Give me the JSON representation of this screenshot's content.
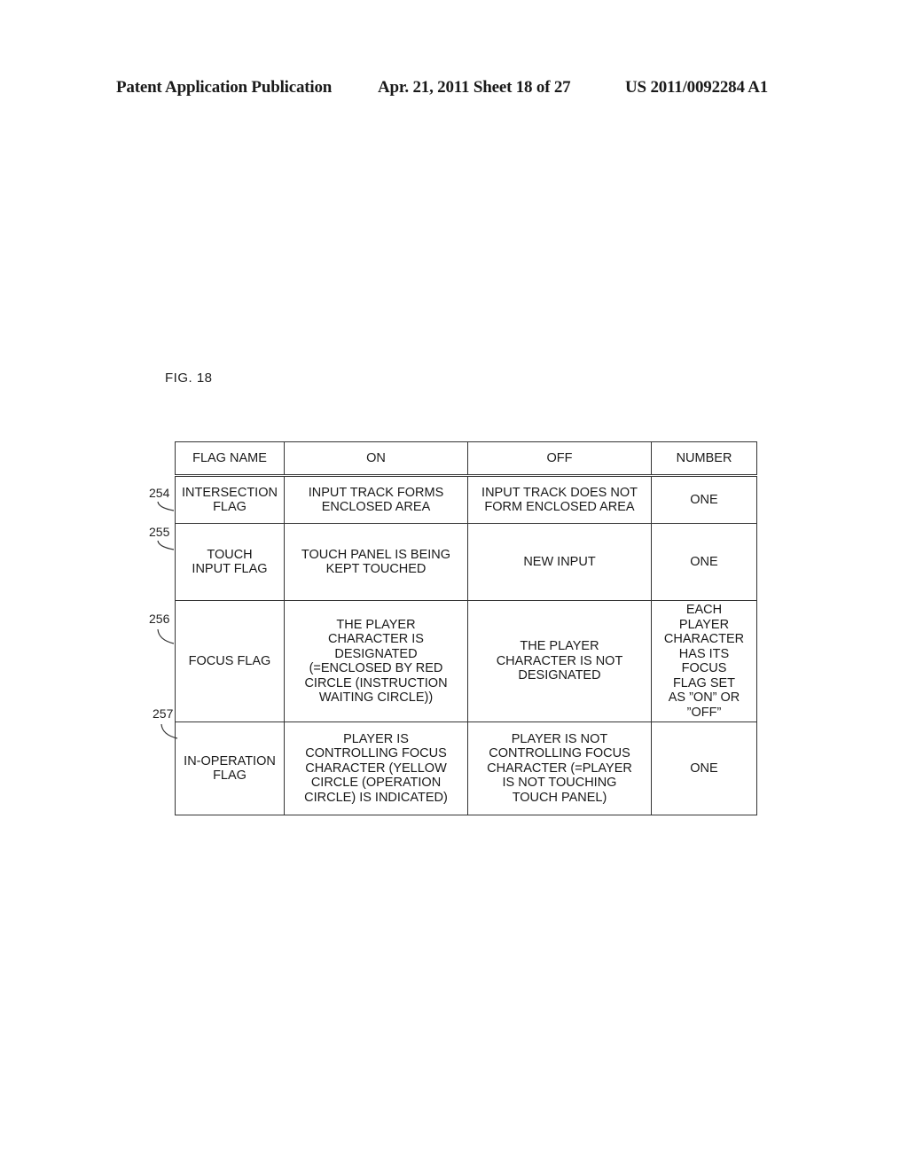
{
  "header": {
    "publication": "Patent Application Publication",
    "date_sheet": "Apr. 21, 2011  Sheet 18 of 27",
    "patent_number": "US 2011/0092284 A1"
  },
  "figure": {
    "label": "FIG. 18"
  },
  "table": {
    "columns": [
      "FLAG NAME",
      "ON",
      "OFF",
      "NUMBER"
    ],
    "rows": [
      {
        "ref": "254",
        "flag_name": "INTERSECTION\nFLAG",
        "on": "INPUT TRACK FORMS\nENCLOSED AREA",
        "off": "INPUT TRACK DOES NOT\nFORM ENCLOSED AREA",
        "number": "ONE"
      },
      {
        "ref": "255",
        "flag_name": "TOUCH\nINPUT FLAG",
        "on": "TOUCH PANEL IS BEING\nKEPT TOUCHED",
        "off": "NEW INPUT",
        "number": "ONE"
      },
      {
        "ref": "256",
        "flag_name": "FOCUS FLAG",
        "on": "THE PLAYER\nCHARACTER IS\nDESIGNATED\n(=ENCLOSED BY RED\nCIRCLE (INSTRUCTION\nWAITING CIRCLE))",
        "off": "THE PLAYER\nCHARACTER IS NOT\nDESIGNATED",
        "number": "EACH\nPLAYER\nCHARACTER\nHAS ITS\nFOCUS\nFLAG SET\nAS ”ON” OR\n”OFF”"
      },
      {
        "ref": "257",
        "flag_name": "IN-OPERATION\nFLAG",
        "on": "PLAYER IS\nCONTROLLING FOCUS\nCHARACTER (YELLOW\nCIRCLE (OPERATION\nCIRCLE) IS INDICATED)",
        "off": "PLAYER IS NOT\nCONTROLLING FOCUS\nCHARACTER (=PLAYER\nIS NOT TOUCHING\nTOUCH PANEL)",
        "number": "ONE"
      }
    ]
  }
}
